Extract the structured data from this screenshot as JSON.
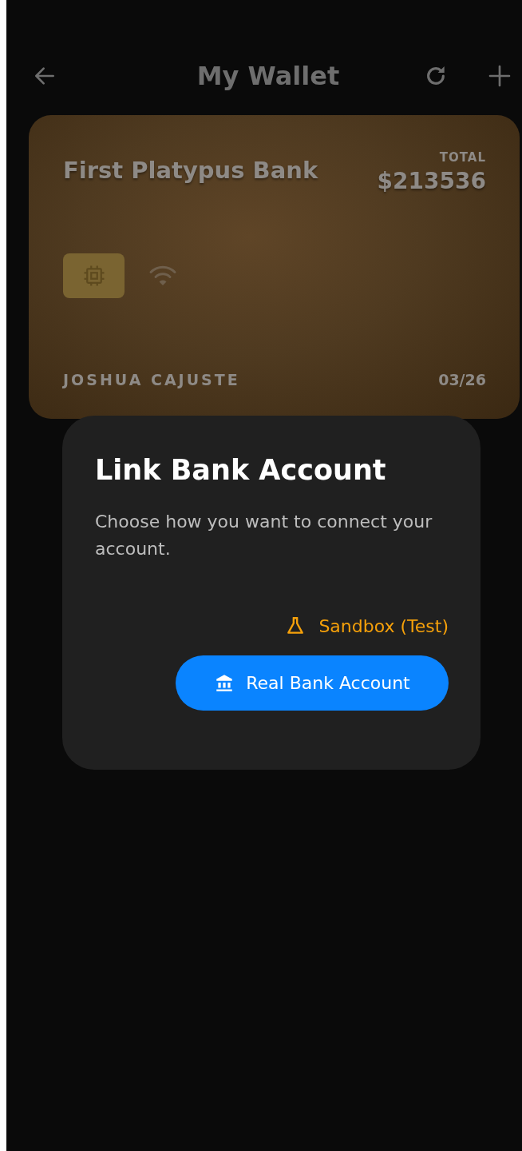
{
  "header": {
    "title": "My Wallet"
  },
  "card": {
    "bank_name": "First Platypus Bank",
    "total_label": "TOTAL",
    "total": "$213536",
    "holder": "JOSHUA CAJUSTE",
    "expiry": "03/26"
  },
  "dialog": {
    "title": "Link Bank Account",
    "message": "Choose how you want to connect your account.",
    "actions": [
      {
        "kind": "link",
        "label": "Sandbox (Test)"
      },
      {
        "kind": "primary",
        "label": "Real Bank Account"
      }
    ]
  }
}
